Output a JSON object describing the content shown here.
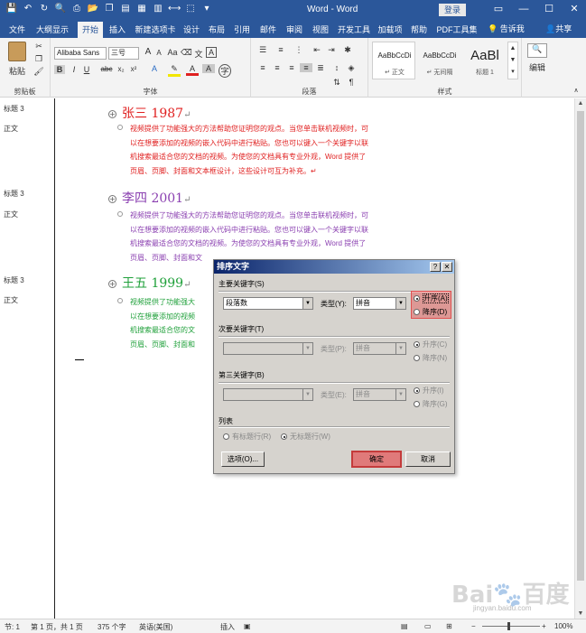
{
  "window": {
    "title": "Word  -  Word",
    "login": "登录",
    "controls": [
      "▭",
      "—",
      "☐",
      "✕"
    ]
  },
  "tabs": [
    "文件",
    "大纲显示",
    "开始",
    "插入",
    "新建选项卡",
    "设计",
    "布局",
    "引用",
    "邮件",
    "审阅",
    "视图",
    "开发工具",
    "加载项",
    "帮助",
    "PDF工具集"
  ],
  "tell_me": "告诉我",
  "share": "共享",
  "ribbon": {
    "clipboard": {
      "paste": "粘贴",
      "label": "剪贴板"
    },
    "font": {
      "name": "Alibaba Sans",
      "size": "三号",
      "label": "字体",
      "bold": "B",
      "italic": "I",
      "underline": "U",
      "strike": "abc",
      "sub": "x₂",
      "sup": "x²",
      "wen": "文",
      "big_a": "A",
      "aa": "Aa"
    },
    "paragraph": {
      "label": "段落"
    },
    "styles": {
      "label": "样式",
      "items": [
        {
          "sample": "AaBbCcDi",
          "name": "↵ 正文"
        },
        {
          "sample": "AaBbCcDi",
          "name": "↵ 无间隔"
        },
        {
          "sample": "AaBl",
          "name": "标题 1"
        }
      ]
    },
    "editing": {
      "label": "编辑"
    }
  },
  "nav_labels": [
    "标题 3",
    "正文",
    "标题 3",
    "正文",
    "标题 3",
    "正文"
  ],
  "document": {
    "headings": [
      "张三 1987",
      "李四 2001",
      "王五 1999"
    ],
    "heading_mark": "↵",
    "para_lines": [
      "视频提供了功能强大的方法帮助您证明您的观点。当您单击联机视频时，可",
      "以在想要添加的视频的嵌入代码中进行粘贴。您也可以键入一个关键字以联",
      "机搜索最适合您的文档的视频。为使您的文档具有专业外观，Word 提供了",
      "页眉、页脚、封面和文本框设计，这些设计可互为补充。↵"
    ],
    "para2_lines": [
      "视频提供了功能强大的方法帮助您证明您的观点。当您单击联机视频时，可",
      "以在想要添加的视频的嵌入代码中进行粘贴。您也可以键入一个关键字以联",
      "机搜索最适合您的文档的视频。为使您的文档具有专业外观，Word 提供了",
      "页眉、页脚、封面和文"
    ],
    "para3_lines": [
      "视频提供了功能强大",
      "以在想要添加的视频",
      "机搜索最适合您的文",
      "页眉、页脚、封面和"
    ]
  },
  "dialog": {
    "title": "排序文字",
    "help_btn": "?",
    "close_btn": "✕",
    "primary_key": "主要关键字(S)",
    "primary_value": "段落数",
    "type_label": "类型(Y):",
    "type_value": "拼音",
    "asc": "升序(A)",
    "desc": "降序(D)",
    "secondary_key": "次要关键字(T)",
    "type2_label": "类型(P):",
    "type2_value": "拼音",
    "asc2": "升序(C)",
    "desc2": "降序(N)",
    "third_key": "第三关键字(B)",
    "type3_label": "类型(E):",
    "type3_value": "拼音",
    "asc3": "升序(I)",
    "desc3": "降序(G)",
    "list_label": "列表",
    "has_header": "有标题行(R)",
    "no_header": "无标题行(W)",
    "options_btn": "选项(O)...",
    "ok_btn": "确定",
    "cancel_btn": "取消"
  },
  "status": {
    "section": "节: 1",
    "page": "第 1 页，共 1 页",
    "words": "375 个字",
    "lang": "英语(美国)",
    "insert": "插入",
    "zoom": "100%"
  },
  "watermark": {
    "logo": "Bai🐾百度",
    "sub": "jingyan.baidu.com"
  }
}
